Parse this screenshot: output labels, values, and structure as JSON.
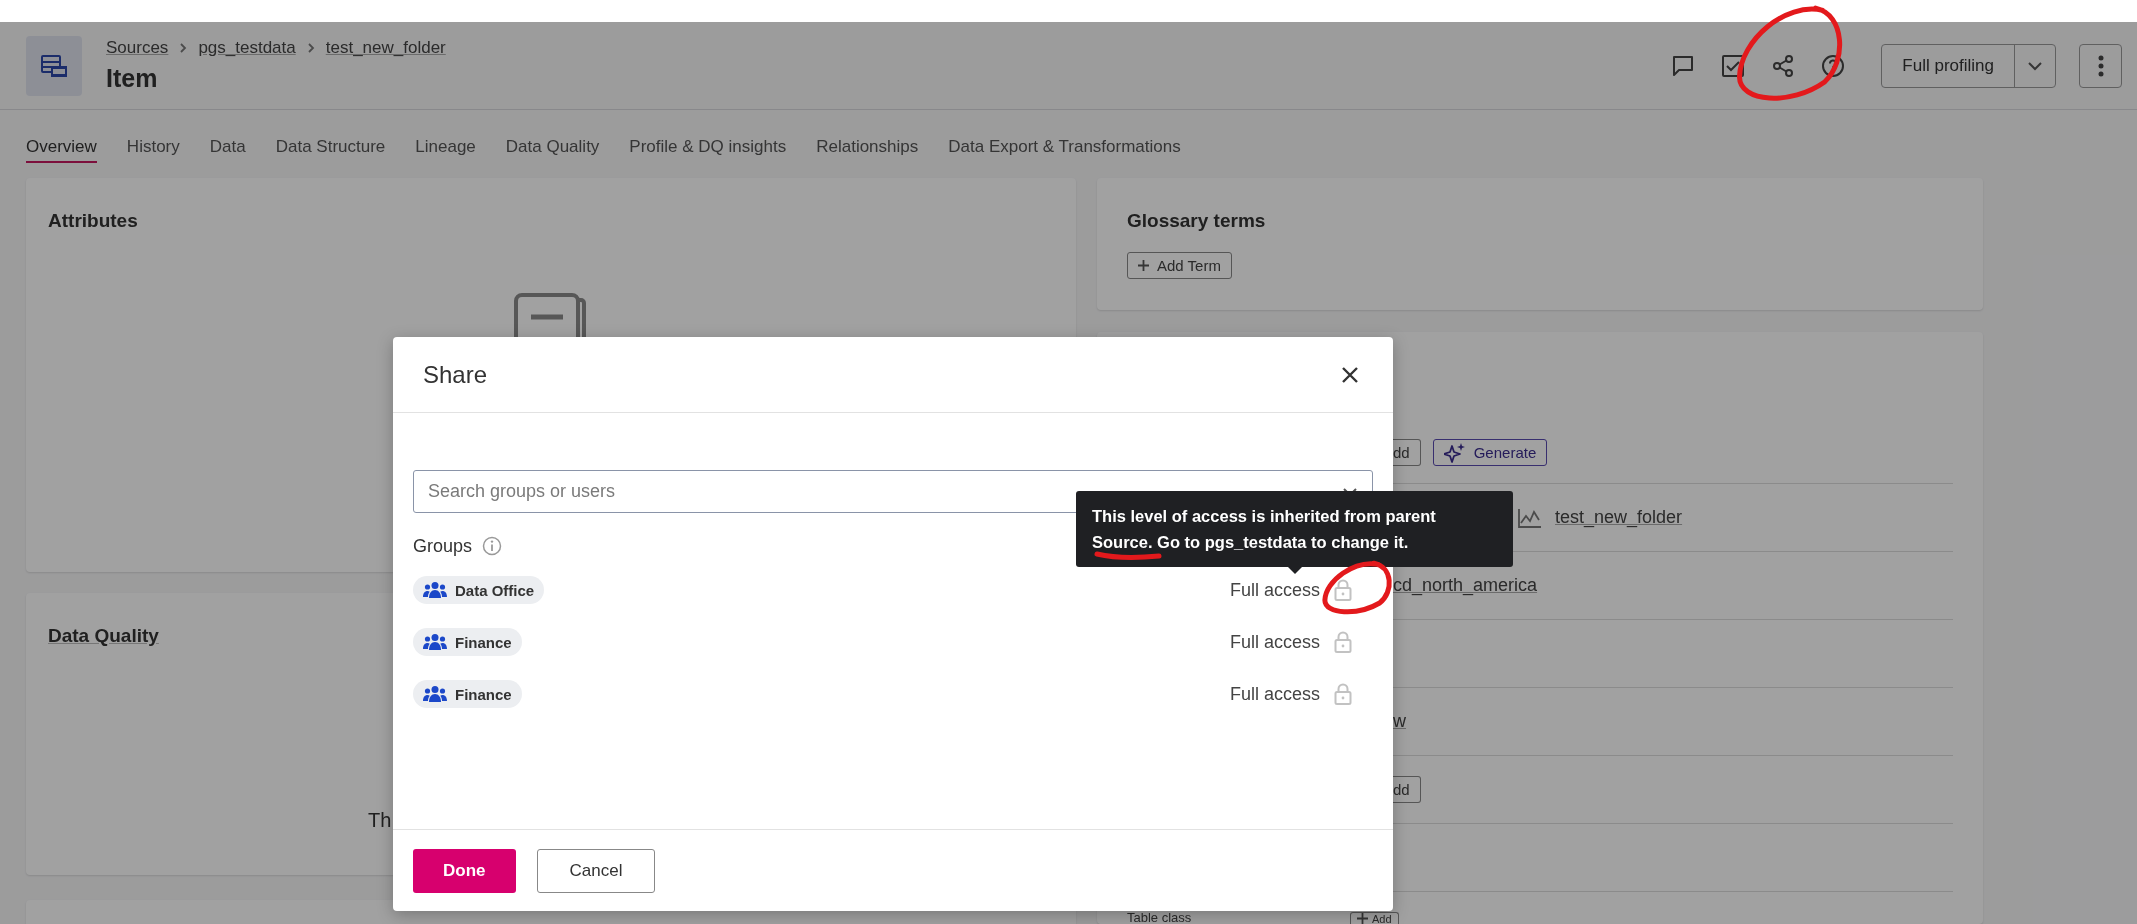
{
  "header": {
    "breadcrumb": [
      "Sources",
      "pgs_testdata",
      "test_new_folder"
    ],
    "title": "Item",
    "profile_button": "Full profiling"
  },
  "tabs": [
    {
      "label": "Overview",
      "selected": true
    },
    {
      "label": "History",
      "selected": false
    },
    {
      "label": "Data",
      "selected": false
    },
    {
      "label": "Data Structure",
      "selected": false
    },
    {
      "label": "Lineage",
      "selected": false
    },
    {
      "label": "Data Quality",
      "selected": false
    },
    {
      "label": "Profile & DQ insights",
      "selected": false
    },
    {
      "label": "Relationships",
      "selected": false
    },
    {
      "label": "Data Export & Transformations",
      "selected": false
    }
  ],
  "attributes_card": {
    "title": "Attributes"
  },
  "data_quality_card": {
    "title": "Data Quality",
    "text": "Th"
  },
  "glossary_card": {
    "title": "Glossary terms",
    "button": "Add Term"
  },
  "details_card": {
    "rows": [
      {
        "kind": "buttons",
        "buttons": [
          {
            "label": "dd",
            "kind": "plain"
          },
          {
            "label": "Generate",
            "kind": "ai"
          }
        ]
      },
      {
        "kind": "lineage",
        "text": "test_new_folder"
      },
      {
        "kind": "link",
        "text": "cd_north_america"
      },
      {
        "kind": "empty"
      },
      {
        "kind": "link",
        "text": "w"
      },
      {
        "kind": "buttons",
        "buttons": [
          {
            "label": "dd",
            "kind": "plain"
          }
        ]
      },
      {
        "kind": "empty"
      },
      {
        "kind": "field",
        "label": "Table class",
        "button": "Add"
      }
    ]
  },
  "share_dialog": {
    "title": "Share",
    "search": {
      "placeholder": "Search groups or users"
    },
    "groups_label": "Groups",
    "groups": [
      {
        "name": "Data Office",
        "access": "Full access",
        "locked": true
      },
      {
        "name": "Finance",
        "access": "Full access",
        "locked": true
      },
      {
        "name": "Finance",
        "access": "Full access",
        "locked": true
      }
    ],
    "buttons": [
      {
        "label": "Done",
        "kind": "primary"
      },
      {
        "label": "Cancel",
        "kind": "secondary"
      }
    ]
  },
  "tooltip": {
    "text": "This level of access is inherited from parent Source. Go to pgs_testdata to change it."
  },
  "annotations": [
    {
      "kind": "circle"
    },
    {
      "kind": "underline"
    },
    {
      "kind": "circle"
    }
  ]
}
